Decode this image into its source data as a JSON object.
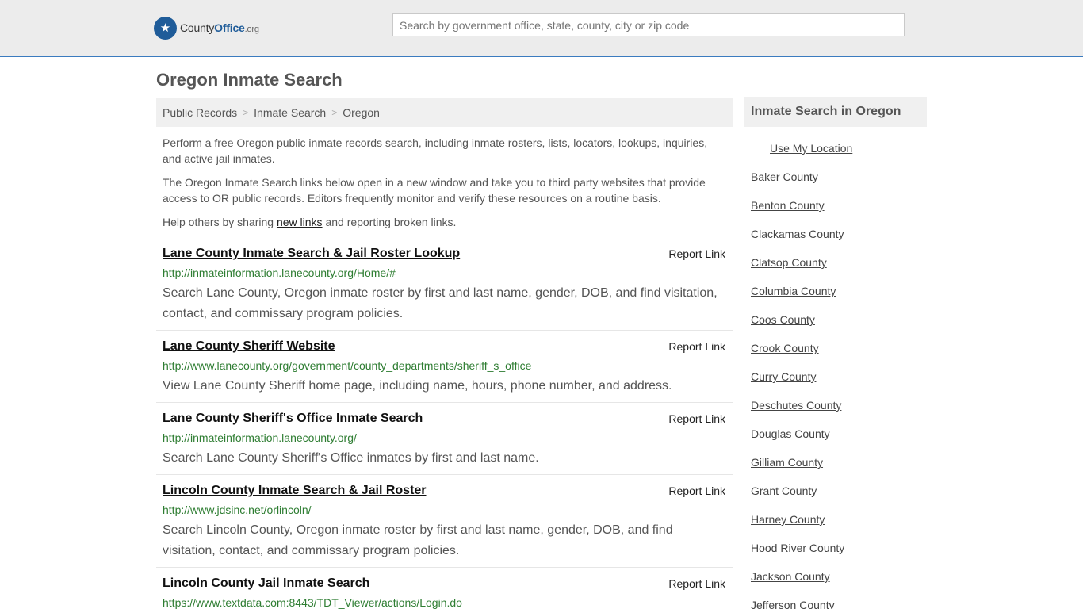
{
  "header": {
    "logo_name": "County",
    "logo_bold": "Office",
    "logo_suffix": ".org",
    "search_placeholder": "Search by government office, state, county, city or zip code"
  },
  "page_title": "Oregon Inmate Search",
  "breadcrumb": [
    "Public Records",
    "Inmate Search",
    "Oregon"
  ],
  "intro": {
    "p1": "Perform a free Oregon public inmate records search, including inmate rosters, lists, locators, lookups, inquiries, and active jail inmates.",
    "p2": "The Oregon Inmate Search links below open in a new window and take you to third party websites that provide access to OR public records. Editors frequently monitor and verify these resources on a routine basis.",
    "p3_before": "Help others by sharing ",
    "p3_link": "new links",
    "p3_after": " and reporting broken links."
  },
  "results": [
    {
      "title": "Lane County Inmate Search & Jail Roster Lookup",
      "report": "Report Link",
      "url": "http://inmateinformation.lanecounty.org/Home/#",
      "desc": "Search Lane County, Oregon inmate roster by first and last name, gender, DOB, and find visitation, contact, and commissary program policies."
    },
    {
      "title": "Lane County Sheriff Website",
      "report": "Report Link",
      "url": "http://www.lanecounty.org/government/county_departments/sheriff_s_office",
      "desc": "View Lane County Sheriff home page, including name, hours, phone number, and address."
    },
    {
      "title": "Lane County Sheriff's Office Inmate Search",
      "report": "Report Link",
      "url": "http://inmateinformation.lanecounty.org/",
      "desc": "Search Lane County Sheriff's Office inmates by first and last name."
    },
    {
      "title": "Lincoln County Inmate Search & Jail Roster",
      "report": "Report Link",
      "url": "http://www.jdsinc.net/orlincoln/",
      "desc": "Search Lincoln County, Oregon inmate roster by first and last name, gender, DOB, and find visitation, contact, and commissary program policies."
    },
    {
      "title": "Lincoln County Jail Inmate Search",
      "report": "Report Link",
      "url": "https://www.textdata.com:8443/TDT_Viewer/actions/Login.do",
      "desc": ""
    }
  ],
  "sidebar": {
    "heading": "Inmate Search in Oregon",
    "use_location": "Use My Location",
    "counties": [
      "Baker County",
      "Benton County",
      "Clackamas County",
      "Clatsop County",
      "Columbia County",
      "Coos County",
      "Crook County",
      "Curry County",
      "Deschutes County",
      "Douglas County",
      "Gilliam County",
      "Grant County",
      "Harney County",
      "Hood River County",
      "Jackson County",
      "Jefferson County"
    ]
  },
  "colors": {
    "accent": "#3b7bbf",
    "logo_blue": "#1f5c99",
    "url_green": "#2e7d32"
  },
  "icons": {
    "logo": "eagle-seal-icon"
  }
}
